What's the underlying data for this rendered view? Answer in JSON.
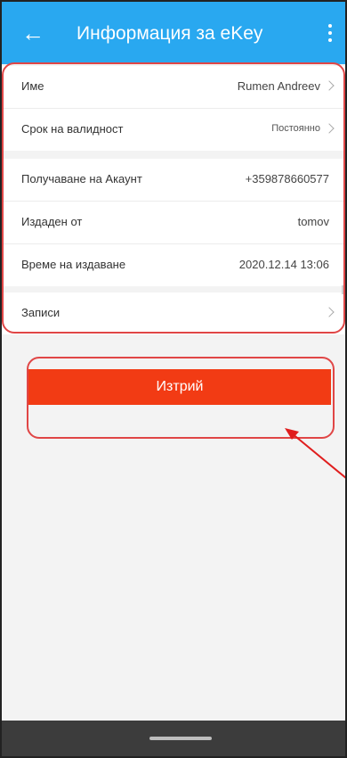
{
  "appbar": {
    "title": "Информация за eKey",
    "back_icon": "arrow-left-icon",
    "menu_icon": "more-vertical-icon",
    "color": "#29a8f0"
  },
  "group1": [
    {
      "label": "Име",
      "value": "Rumen Andreev"
    },
    {
      "label": "Срок на валидност",
      "value": "Постоянно"
    }
  ],
  "group2": [
    {
      "label": "Получаване на Акаунт",
      "value": "+359878660577"
    },
    {
      "label": "Издаден от",
      "value": "tomov"
    },
    {
      "label": "Време на издаване",
      "value": "2020.12.14 13:06"
    }
  ],
  "group3": [
    {
      "label": "Записи"
    }
  ],
  "delete_label": "Изтрий",
  "colors": {
    "accent": "#f23b14",
    "annotation": "#e04646"
  }
}
